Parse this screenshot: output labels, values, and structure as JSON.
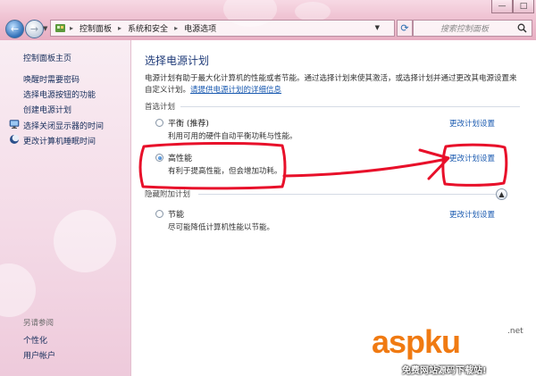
{
  "address_bar": {
    "breadcrumbs": [
      "控制面板",
      "系统和安全",
      "电源选项"
    ],
    "search_placeholder": "搜索控制面板"
  },
  "sidebar": {
    "home": "控制面板主页",
    "items": [
      {
        "label": "唤醒时需要密码",
        "icon": ""
      },
      {
        "label": "选择电源按钮的功能",
        "icon": ""
      },
      {
        "label": "创建电源计划",
        "icon": ""
      },
      {
        "label": "选择关闭显示器的时间",
        "icon": "monitor-icon"
      },
      {
        "label": "更改计算机睡眠时间",
        "icon": "moon-icon"
      }
    ],
    "see_also_title": "另请参阅",
    "see_also": [
      "个性化",
      "用户帐户"
    ]
  },
  "main": {
    "title": "选择电源计划",
    "description": "电源计划有助于最大化计算机的性能或者节能。通过选择计划来使其激活，或选择计划并通过更改其电源设置来自定义计划。",
    "description_link": "请提供电源计划的详细信息",
    "preferred_section": "首选计划",
    "hidden_section": "隐藏附加计划",
    "plans": [
      {
        "name": "平衡 (推荐)",
        "description": "利用可用的硬件自动平衡功耗与性能。",
        "selected": false,
        "change_link": "更改计划设置"
      },
      {
        "name": "高性能",
        "description": "有利于提高性能，但会增加功耗。",
        "selected": true,
        "change_link": "更改计划设置"
      },
      {
        "name": "节能",
        "description": "尽可能降低计算机性能以节能。",
        "selected": false,
        "change_link": "更改计划设置"
      }
    ]
  },
  "watermark": {
    "brand": "aspku",
    "tld": ".net",
    "tagline": "免费网站源码下载站!"
  },
  "colors": {
    "accent": "#1a5ab0",
    "annotation": "#e8102a",
    "brand_orange": "#f07a12",
    "brand_dark": "#1a2a6c"
  }
}
